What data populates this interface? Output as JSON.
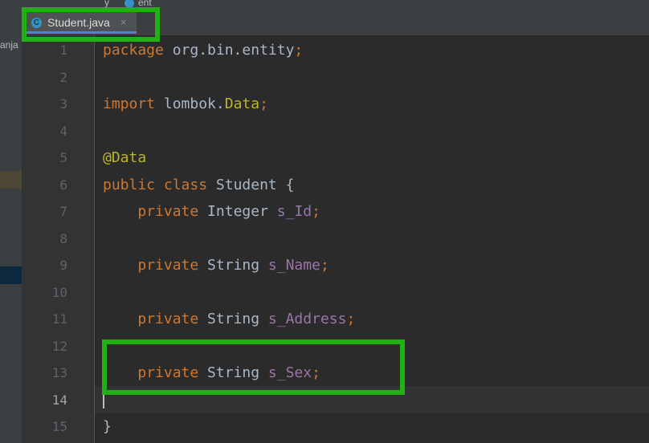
{
  "breadcrumb": {
    "items": [
      "",
      "y",
      "ent"
    ]
  },
  "tab": {
    "icon_letter": "C",
    "label": "Student.java",
    "close_glyph": "×"
  },
  "project_panel": {
    "collapse_glyph": "—",
    "label_fragment": "anja"
  },
  "editor": {
    "current_line": 14,
    "line_numbers": [
      "1",
      "2",
      "3",
      "4",
      "5",
      "6",
      "7",
      "8",
      "9",
      "10",
      "11",
      "12",
      "13",
      "14",
      "15"
    ],
    "lines": {
      "l1": {
        "kw": "package",
        "name": " org.bin.entity",
        "semi": ";"
      },
      "l3": {
        "kw": "import",
        "name": " lombok.",
        "cls": "Data",
        "semi": ";"
      },
      "l5": {
        "ann": "@Data"
      },
      "l6": {
        "kw1": "public",
        "kw2": " class",
        "name": " Student ",
        "brace": "{"
      },
      "l7": {
        "indent": "    ",
        "kw": "private",
        "type": " Integer ",
        "field": "s_Id",
        "semi": ";"
      },
      "l9": {
        "indent": "    ",
        "kw": "private",
        "type": " String ",
        "field": "s_Name",
        "semi": ";"
      },
      "l11": {
        "indent": "    ",
        "kw": "private",
        "type": " String ",
        "field": "s_Address",
        "semi": ";"
      },
      "l13": {
        "indent": "    ",
        "kw": "private",
        "type": " String ",
        "field": "s_Sex",
        "semi": ";"
      },
      "l15": {
        "brace": "}"
      }
    }
  },
  "colors": {
    "background": "#2b2b2b",
    "keyword": "#cc7832",
    "annotation": "#bbb529",
    "field": "#9876aa",
    "text": "#a9b7c6",
    "highlight_box": "#22b114"
  }
}
